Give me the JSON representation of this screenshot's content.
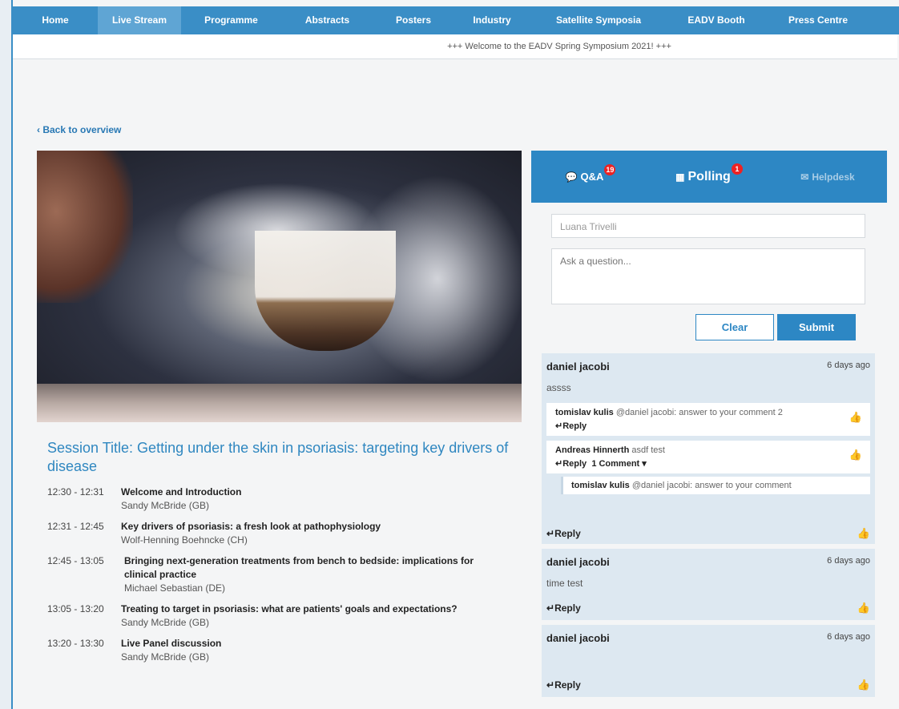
{
  "nav": {
    "items": [
      {
        "label": "Home",
        "active": false
      },
      {
        "label": "Live Stream",
        "active": true
      },
      {
        "label": "Programme",
        "active": false
      },
      {
        "label": "Abstracts",
        "active": false
      },
      {
        "label": "Posters",
        "active": false
      },
      {
        "label": "Industry",
        "active": false
      },
      {
        "label": "Satellite Symposia",
        "active": false
      },
      {
        "label": "EADV Booth",
        "active": false
      },
      {
        "label": "Press Centre",
        "active": false
      }
    ]
  },
  "ticker": "+++ Welcome to the EADV Spring Symposium 2021! +++",
  "back_label": "Back to overview",
  "session": {
    "title": "Session Title: Getting under the skin in psoriasis: targeting key drivers of disease",
    "agenda": [
      {
        "time": "12:30 - 12:31",
        "talk": "Welcome and Introduction",
        "speaker": "Sandy McBride (GB)"
      },
      {
        "time": "12:31 - 12:45",
        "talk": "Key drivers of psoriasis: a fresh look at pathophysiology",
        "speaker": "Wolf-Henning Boehncke (CH)"
      },
      {
        "time": "12:45 - 13:05",
        "talk": "Bringing next-generation treatments from bench to bedside: implications for clinical practice",
        "speaker": "Michael Sebastian (DE)"
      },
      {
        "time": "13:05 - 13:20",
        "talk": "Treating to target in psoriasis: what are patients' goals and expectations?",
        "speaker": "Sandy McBride (GB)"
      },
      {
        "time": "13:20 - 13:30",
        "talk": "Live Panel discussion",
        "speaker": "Sandy McBride (GB)"
      }
    ]
  },
  "panel": {
    "tabs": {
      "qa": {
        "label": "Q&A",
        "badge": "19"
      },
      "polling": {
        "label": "Polling",
        "badge": "1"
      },
      "helpdesk": {
        "label": "Helpdesk"
      }
    },
    "name_value": "Luana Trivelli",
    "question_placeholder": "Ask a question...",
    "clear_label": "Clear",
    "submit_label": "Submit"
  },
  "comments": [
    {
      "author": "daniel jacobi",
      "time": "6 days ago",
      "text": "assss",
      "replies": [
        {
          "author": "tomislav kulis",
          "mention": "@daniel jacobi: answer to your comment 2"
        },
        {
          "author": "Andreas Hinnerth",
          "mention": "asdf test",
          "comment_count": "1 Comment",
          "subreply": {
            "author": "tomislav kulis",
            "mention": "@daniel jacobi: answer to your comment"
          }
        }
      ]
    },
    {
      "author": "daniel jacobi",
      "time": "6 days ago",
      "text": "time test"
    },
    {
      "author": "daniel jacobi",
      "time": "6 days ago",
      "text": ""
    }
  ],
  "reply_label": "Reply",
  "icons": {
    "thumb": "thumbs-up-icon",
    "reply": "reply-icon",
    "back": "chevron-left-icon"
  },
  "colors": {
    "accent": "#2d87c4",
    "nav": "#3a8ec6",
    "badge": "#e22222",
    "card": "#dde8f1"
  }
}
